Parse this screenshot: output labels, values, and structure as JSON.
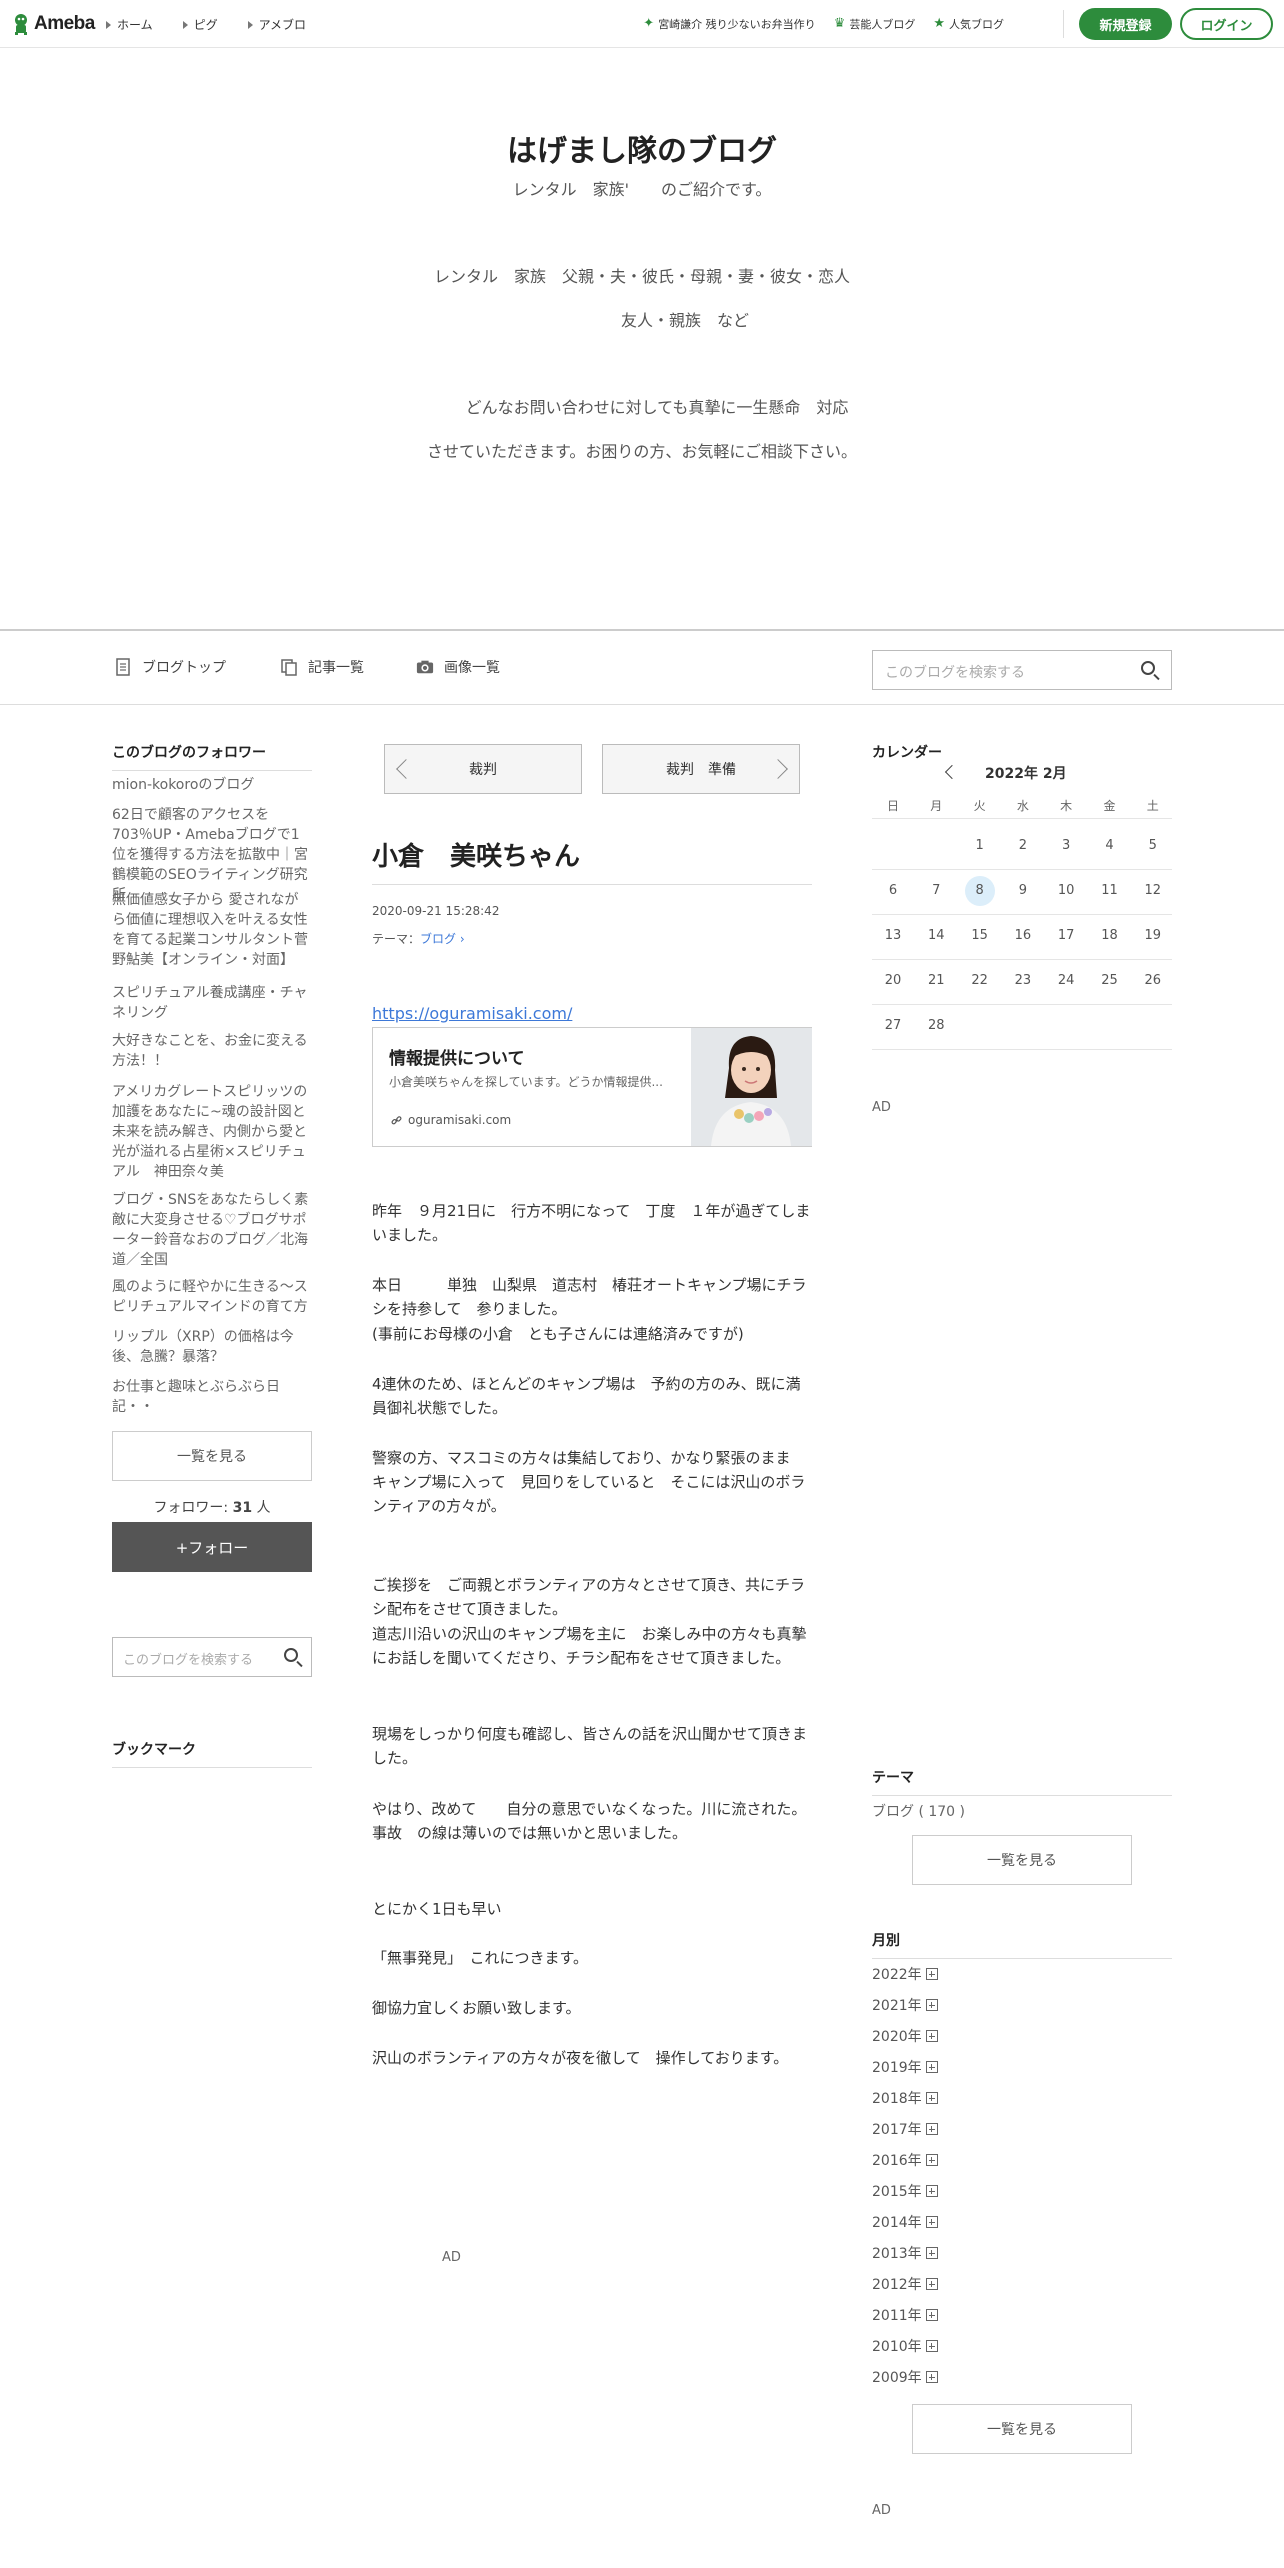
{
  "topnav": {
    "logo_text": "Ameba",
    "links": [
      "ホーム",
      "ピグ",
      "アメブロ"
    ],
    "right_links": [
      {
        "icon": "sparkle-icon",
        "label": "宮崎謙介 残り少ないお弁当作り"
      },
      {
        "icon": "crown-icon",
        "label": "芸能人ブログ"
      },
      {
        "icon": "star-icon",
        "label": "人気ブログ"
      }
    ],
    "register_label": "新規登録",
    "login_label": "ログイン",
    "accent_color": "#2d8c3c"
  },
  "blog": {
    "title": "はげまし隊のブログ",
    "description": "レンタル　家族'　　のご紹介です。",
    "hero_lines": [
      "レンタル　家族　父親・夫・彼氏・母親・妻・彼女・恋人",
      "友人・親族　など",
      "どんなお問い合わせに対しても真摯に一生懸命　対応",
      "させていただきます。お困りの方、お気軽にご相談下さい。"
    ]
  },
  "menubar": {
    "items": [
      {
        "icon": "document-icon",
        "label": "ブログトップ"
      },
      {
        "icon": "copy-icon",
        "label": "記事一覧"
      },
      {
        "icon": "camera-icon",
        "label": "画像一覧"
      }
    ],
    "search_placeholder": "このブログを検索する"
  },
  "left_sidebar": {
    "followers_heading": "このブログのフォロワー",
    "followers": [
      "mion-kokoroのブログ",
      "62日で顧客のアクセスを703％UP・Amebaブログで1位を獲得する方法を拡散中｜宮鶴模範のSEOライティング研究所",
      "無価値感女子から 愛されながら価値に理想収入を叶える女性を育てる起業コンサルタント菅野鮎美【オンライン・対面】",
      "スピリチュアル養成講座・チャネリング",
      "大好きなことを、お金に変える方法！！",
      "アメリカグレートスピリッツの加護をあなたに~魂の設計図と未来を読み解き、内側から愛と光が溢れる占星術×スピリチュアル　神田奈々美",
      "ブログ・SNSをあなたらしく素敵に大変身させる♡ブログサポーター鈴音なおのブログ／北海道／全国",
      "風のように軽やかに生きる〜スピリチュアルマインドの育て方",
      "リップル（XRP）の価格は今後、急騰？暴落？",
      "お仕事と趣味とぶらぶら日記・・"
    ],
    "see_all_label": "一覧を見る",
    "follower_count_label": "フォロワー:",
    "follower_count": "31",
    "follower_unit": "人",
    "follow_label": "+フォロー",
    "search_placeholder": "このブログを検索する",
    "bookmark_heading": "ブックマーク"
  },
  "article": {
    "prev_label": "裁判",
    "next_label": "裁判　準備",
    "title": "小倉　美咲ちゃん",
    "date": "2020-09-21 15:28:42",
    "theme_prefix": "テーマ：",
    "theme": "ブログ",
    "link": "https://oguramisaki.com/",
    "card": {
      "title": "情報提供について",
      "description": "小倉美咲ちゃんを探しています。どうか情報提供...",
      "domain": "oguramisaki.com"
    },
    "paragraphs": [
      "昨年　９月21日に　行方不明になって　丁度　１年が過ぎてしまいました。",
      "本日　　　単独　山梨県　道志村　椿荘オートキャンプ場にチラシを持参して　参りました。",
      "(事前にお母様の小倉　とも子さんには連絡済みですが)",
      "4連休のため、ほとんどのキャンプ場は　予約の方のみ、既に満員御礼状態でした。",
      "警察の方、マスコミの方々は集結しており、かなり緊張のまま　キャンプ場に入って　見回りをしていると　そこには沢山のボランティアの方々が。",
      "ご挨拶を　ご両親とボランティアの方々とさせて頂き、共にチラシ配布をさせて頂きました。",
      "道志川沿いの沢山のキャンプ場を主に　お楽しみ中の方々も真摯にお話しを聞いてくださり、チラシ配布をさせて頂きました。",
      "現場をしっかり何度も確認し、皆さんの話を沢山聞かせて頂きました。",
      "やはり、改めて　　自分の意思でいなくなった。川に流された。事故　の線は薄いのでは無いかと思いました。",
      "とにかく1日も早い",
      "「無事発見」　これにつきます。",
      "御協力宜しくお願い致します。",
      "沢山のボランティアの方々が夜を徹して　操作しております。"
    ],
    "ad_label": "AD"
  },
  "right_sidebar": {
    "calendar_heading": "カレンダー",
    "calendar_month": "2022年 2月",
    "weekdays": [
      "日",
      "月",
      "火",
      "水",
      "木",
      "金",
      "土"
    ],
    "weeks": [
      [
        "",
        "",
        "1",
        "2",
        "3",
        "4",
        "5"
      ],
      [
        "6",
        "7",
        "8",
        "9",
        "10",
        "11",
        "12"
      ],
      [
        "13",
        "14",
        "15",
        "16",
        "17",
        "18",
        "19"
      ],
      [
        "20",
        "21",
        "22",
        "23",
        "24",
        "25",
        "26"
      ],
      [
        "27",
        "28",
        "",
        "",
        "",
        "",
        ""
      ]
    ],
    "today": "8",
    "ad_label": "AD",
    "theme_heading": "テーマ",
    "theme_item": "ブログ ( 170 )",
    "see_all_label": "一覧を見る",
    "monthly_heading": "月別",
    "years": [
      "2022年",
      "2021年",
      "2020年",
      "2019年",
      "2018年",
      "2017年",
      "2016年",
      "2015年",
      "2014年",
      "2013年",
      "2012年",
      "2011年",
      "2010年",
      "2009年"
    ],
    "monthly_see_all_label": "一覧を見る",
    "bottom_ad_label": "AD"
  }
}
